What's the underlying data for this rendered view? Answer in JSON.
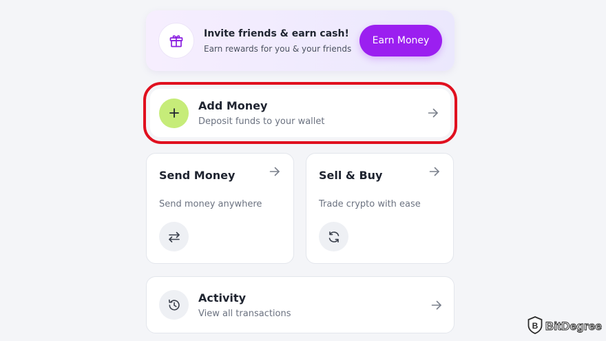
{
  "invite": {
    "icon": "gift-icon",
    "title": "Invite friends & earn cash!",
    "subtitle": "Earn rewards for you & your friends",
    "button_label": "Earn Money",
    "button_color": "#9b1ff0"
  },
  "add_money": {
    "icon": "plus-icon",
    "title": "Add Money",
    "subtitle": "Deposit funds to your wallet",
    "icon_bg": "#c6ec79",
    "highlight_color": "#e0101f"
  },
  "send_money": {
    "icon": "swap-arrows-icon",
    "title": "Send Money",
    "subtitle": "Send money anywhere"
  },
  "sell_buy": {
    "icon": "refresh-icon",
    "title": "Sell & Buy",
    "subtitle": "Trade crypto with ease"
  },
  "activity": {
    "icon": "history-icon",
    "title": "Activity",
    "subtitle": "View all transactions"
  },
  "watermark": {
    "text": "BitDegree",
    "icon": "bitdegree-logo-icon"
  }
}
